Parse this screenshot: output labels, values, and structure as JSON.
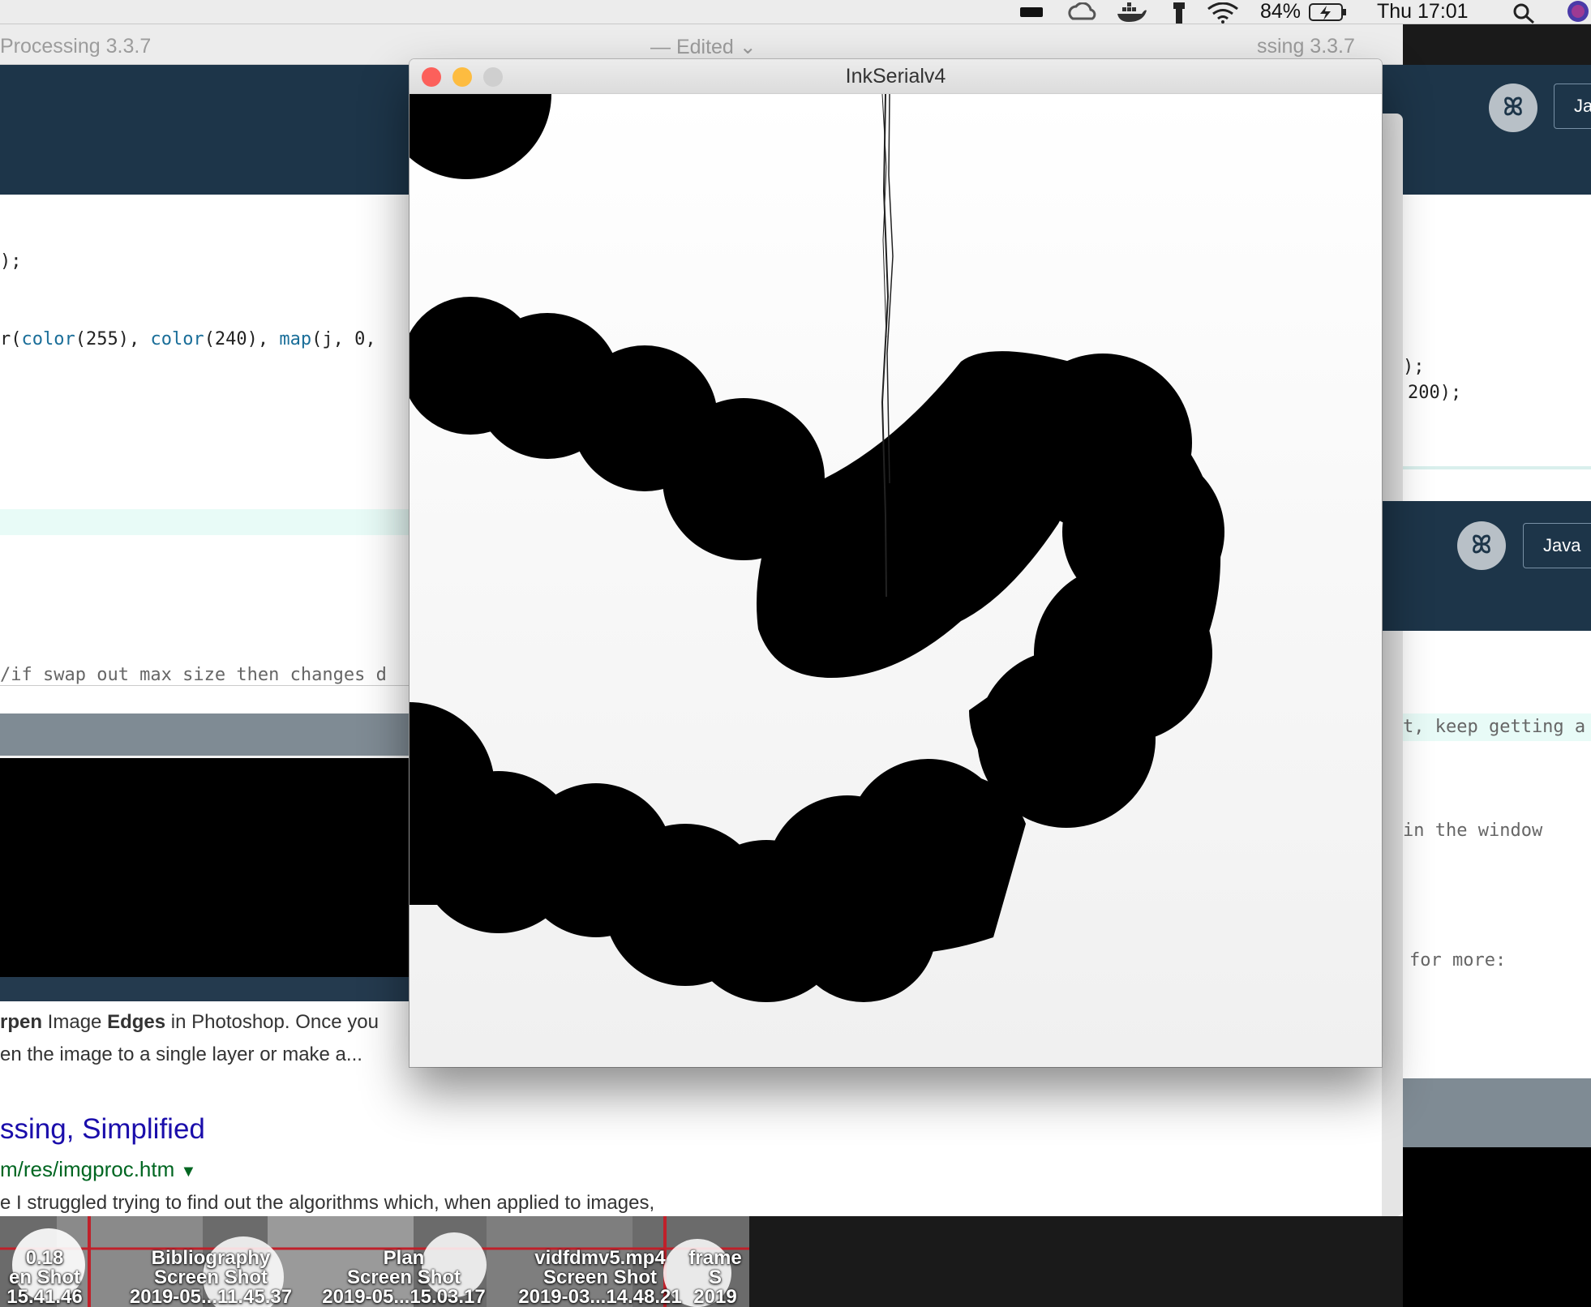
{
  "menubar": {
    "battery": "84%",
    "clock": "Thu 17:01",
    "icons": [
      "battery-bar-icon",
      "creative-cloud-icon",
      "docker-icon",
      "flashlight-icon",
      "wifi-icon",
      "battery-charging-icon",
      "spotlight-search-icon",
      "siri-icon"
    ]
  },
  "back_window": {
    "title_left": "Processing 3.3.7",
    "title_mid": "— Edited ⌄",
    "title_right": "ssing 3.3.7",
    "mode_label": "Java",
    "mode_label_right": "Ja"
  },
  "code_left": {
    "line1": ");",
    "line2_prefix": "r(",
    "line2_kw1": "color",
    "line2_a": "(255), ",
    "line2_kw2": "color",
    "line2_b": "(240), ",
    "line2_kw3": "map",
    "line2_c": "(j, 0,",
    "comment": "/if swap out max size then changes d"
  },
  "code_right": {
    "line1": ");",
    "line2": "200);",
    "highlight": "t, keep getting a",
    "line3": "in the window",
    "line4": "for more:"
  },
  "search": {
    "snippet1_bold1": "rpen",
    "snippet1_plain1": " Image ",
    "snippet1_bold2": "Edges",
    "snippet1_plain2": " in Photoshop. Once you",
    "snippet1_line2": "en the image to a single layer or make a...",
    "result_title": "ssing, Simplified",
    "result_url": "m/res/imgproc.htm",
    "result_snippet": "e I struggled trying to find out the algorithms which, when applied to images,"
  },
  "desktop_files": [
    {
      "line1": "0.18",
      "line2": "en Shot",
      "line3": "15.41.46"
    },
    {
      "line1": "Bibliography",
      "line2": "Screen Shot",
      "line3": "2019-05...11.45.37"
    },
    {
      "line1": "Plan",
      "line2": "Screen Shot",
      "line3": "2019-05...15.03.17"
    },
    {
      "line1": "vidfdmv5.mp4",
      "line2": "Screen Shot",
      "line3": "2019-03...14.48.21"
    },
    {
      "line1": "frame",
      "line2": "S",
      "line3": "2019"
    }
  ],
  "sketch_window": {
    "title": "InkSerialv4",
    "close_color": "#fc605b",
    "minimize_color": "#fdbc40",
    "zoom_color": "#cfcfcf"
  }
}
